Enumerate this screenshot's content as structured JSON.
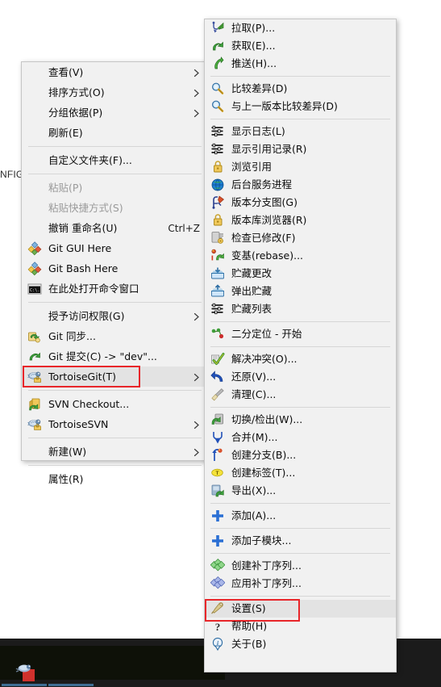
{
  "desktop": {
    "background_text": "NFIG"
  },
  "taskbar": {
    "icon": "tortoisegit-taskbar-icon"
  },
  "context_menu": {
    "name": "explorer-context-menu",
    "items": [
      {
        "label": "查看(V)",
        "icon": "none",
        "submenu": true,
        "disabled": false
      },
      {
        "label": "排序方式(O)",
        "icon": "none",
        "submenu": true,
        "disabled": false
      },
      {
        "label": "分组依据(P)",
        "icon": "none",
        "submenu": true,
        "disabled": false
      },
      {
        "label": "刷新(E)",
        "icon": "none",
        "submenu": false,
        "disabled": false
      },
      {
        "separator": true
      },
      {
        "label": "自定义文件夹(F)...",
        "icon": "none",
        "submenu": false,
        "disabled": false
      },
      {
        "separator": true
      },
      {
        "label": "粘贴(P)",
        "icon": "none",
        "submenu": false,
        "disabled": true
      },
      {
        "label": "粘贴快捷方式(S)",
        "icon": "none",
        "submenu": false,
        "disabled": true
      },
      {
        "label": "撤销 重命名(U)",
        "icon": "none",
        "submenu": false,
        "disabled": false,
        "accel": "Ctrl+Z"
      },
      {
        "label": "Git GUI Here",
        "icon": "git-gui-icon",
        "submenu": false,
        "disabled": false
      },
      {
        "label": "Git Bash Here",
        "icon": "git-bash-icon",
        "submenu": false,
        "disabled": false
      },
      {
        "label": "在此处打开命令窗口",
        "icon": "cmd-prompt-icon",
        "submenu": false,
        "disabled": false
      },
      {
        "separator": true
      },
      {
        "label": "授予访问权限(G)",
        "icon": "none",
        "submenu": true,
        "disabled": false
      },
      {
        "label": "Git 同步...",
        "icon": "git-sync-icon",
        "submenu": false,
        "disabled": false
      },
      {
        "label": "Git 提交(C) -> \"dev\"...",
        "icon": "git-commit-icon",
        "submenu": false,
        "disabled": false
      },
      {
        "label": "TortoiseGit(T)",
        "icon": "tortoisegit-icon",
        "submenu": true,
        "disabled": false,
        "highlighted": true,
        "redbox": true
      },
      {
        "separator": true
      },
      {
        "label": "SVN Checkout...",
        "icon": "svn-checkout-icon",
        "submenu": false,
        "disabled": false
      },
      {
        "label": "TortoiseSVN",
        "icon": "tortoisesvn-icon",
        "submenu": true,
        "disabled": false
      },
      {
        "separator": true
      },
      {
        "label": "新建(W)",
        "icon": "none",
        "submenu": true,
        "disabled": false
      },
      {
        "separator": true
      },
      {
        "label": "属性(R)",
        "icon": "none",
        "submenu": false,
        "disabled": false
      }
    ]
  },
  "tortoisegit_submenu": {
    "name": "tortoisegit-submenu",
    "items": [
      {
        "label": "拉取(P)...",
        "icon": "pull-icon"
      },
      {
        "label": "获取(E)...",
        "icon": "fetch-icon"
      },
      {
        "label": "推送(H)...",
        "icon": "push-icon"
      },
      {
        "separator": true
      },
      {
        "label": "比较差异(D)",
        "icon": "diff-icon"
      },
      {
        "label": "与上一版本比较差异(D)",
        "icon": "diff-prev-icon"
      },
      {
        "separator": true
      },
      {
        "label": "显示日志(L)",
        "icon": "log-icon"
      },
      {
        "label": "显示引用记录(R)",
        "icon": "reflog-icon"
      },
      {
        "label": "浏览引用",
        "icon": "browse-refs-icon"
      },
      {
        "label": "后台服务进程",
        "icon": "daemon-icon"
      },
      {
        "label": "版本分支图(G)",
        "icon": "revision-graph-icon"
      },
      {
        "label": "版本库浏览器(R)",
        "icon": "repo-browser-icon"
      },
      {
        "label": "检查已修改(F)",
        "icon": "check-modifications-icon"
      },
      {
        "label": "变基(rebase)...",
        "icon": "rebase-icon"
      },
      {
        "label": "贮藏更改",
        "icon": "stash-save-icon"
      },
      {
        "label": "弹出贮藏",
        "icon": "stash-pop-icon"
      },
      {
        "label": "贮藏列表",
        "icon": "stash-list-icon"
      },
      {
        "separator": true
      },
      {
        "label": "二分定位 - 开始",
        "icon": "bisect-start-icon"
      },
      {
        "separator": true
      },
      {
        "label": "解决冲突(O)...",
        "icon": "resolve-icon"
      },
      {
        "label": "还原(V)...",
        "icon": "revert-icon"
      },
      {
        "label": "清理(C)...",
        "icon": "cleanup-icon"
      },
      {
        "separator": true
      },
      {
        "label": "切换/检出(W)...",
        "icon": "switch-checkout-icon"
      },
      {
        "label": "合并(M)...",
        "icon": "merge-icon"
      },
      {
        "label": "创建分支(B)...",
        "icon": "create-branch-icon"
      },
      {
        "label": "创建标签(T)...",
        "icon": "create-tag-icon"
      },
      {
        "label": "导出(X)...",
        "icon": "export-icon"
      },
      {
        "separator": true
      },
      {
        "label": "添加(A)...",
        "icon": "add-icon"
      },
      {
        "separator": true
      },
      {
        "label": "添加子模块...",
        "icon": "add-submodule-icon"
      },
      {
        "separator": true
      },
      {
        "label": "创建补丁序列...",
        "icon": "create-patch-icon"
      },
      {
        "label": "应用补丁序列...",
        "icon": "apply-patch-icon"
      },
      {
        "separator": true
      },
      {
        "label": "设置(S)",
        "icon": "settings-icon",
        "highlighted": true,
        "redbox": true
      },
      {
        "label": "帮助(H)",
        "icon": "help-icon"
      },
      {
        "label": "关于(B)",
        "icon": "about-icon"
      }
    ]
  },
  "colors": {
    "menu_bg": "#f1f1f1",
    "menu_border": "#c6c6c6",
    "highlight": "#e3e3e3",
    "redbox": "#e8262a",
    "taskbar": "#1b1b1b",
    "text": "#0b0b0b",
    "disabled_text": "#9a9a9a"
  }
}
